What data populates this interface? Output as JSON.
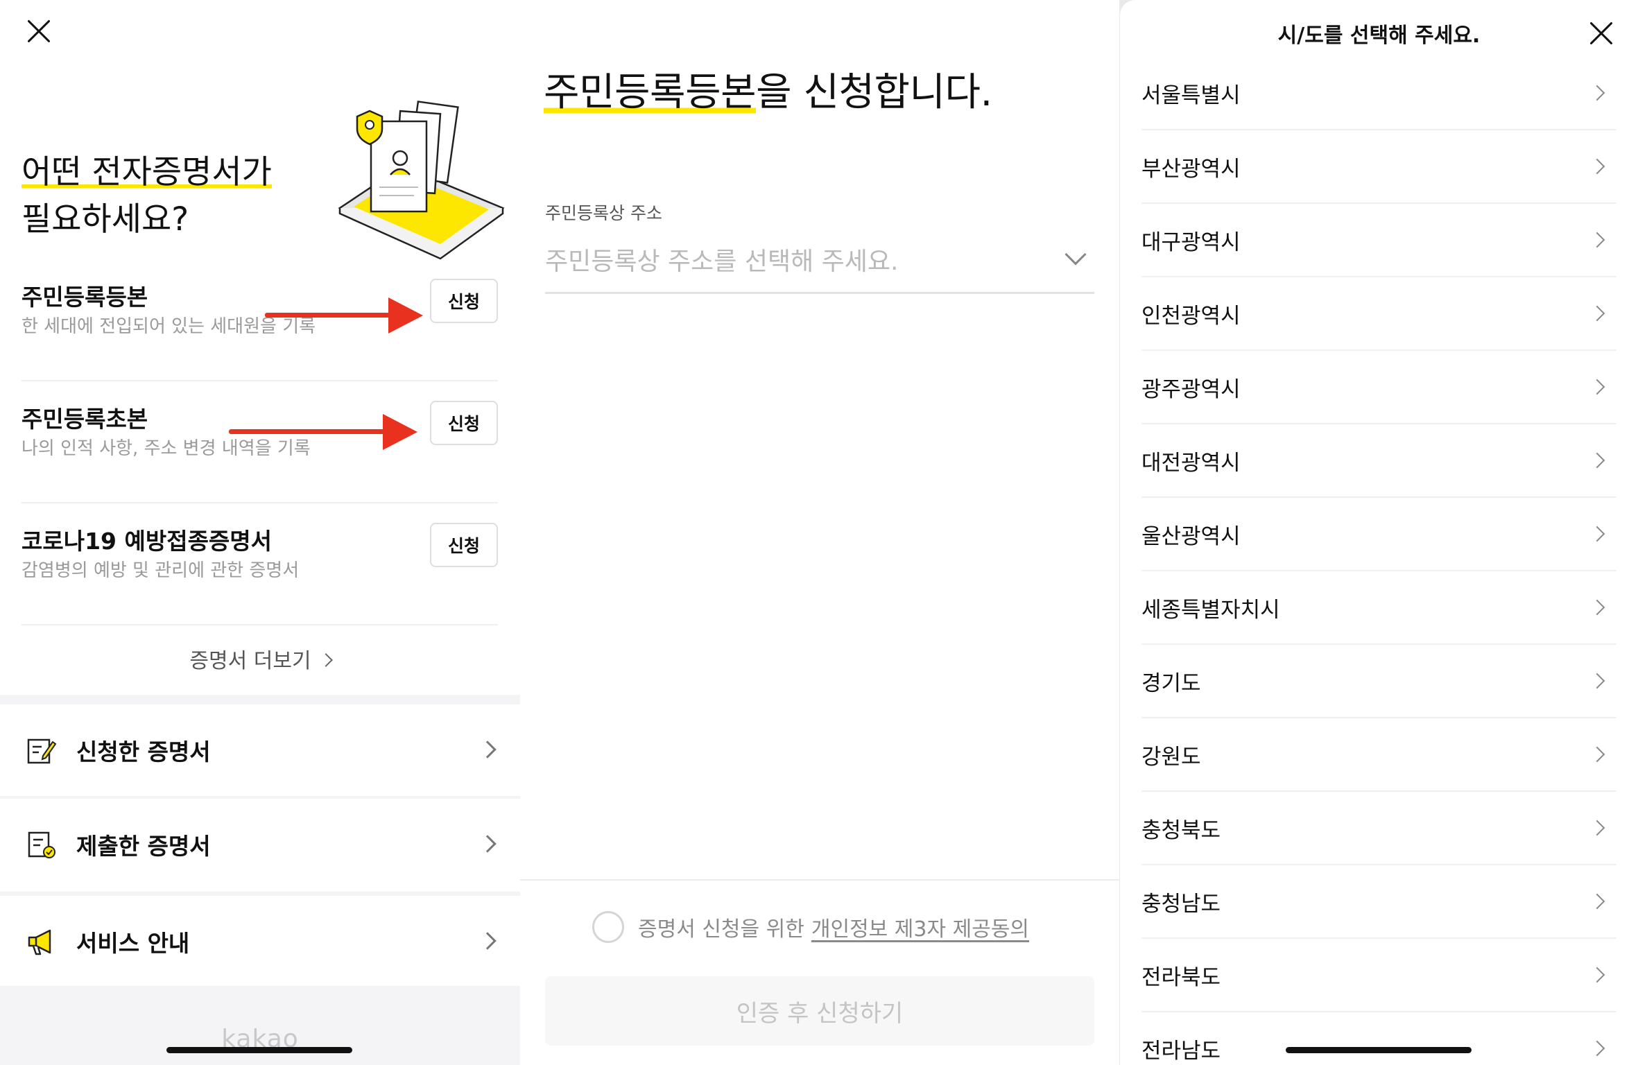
{
  "left": {
    "heading_line1": "어떤 전자증명서가",
    "heading_line2": "필요하세요?",
    "certificates": [
      {
        "title": "주민등록등본",
        "desc": "한 세대에 전입되어 있는 세대원을 기록",
        "button": "신청"
      },
      {
        "title": "주민등록초본",
        "desc": "나의 인적 사항, 주소 변경 내역을 기록",
        "button": "신청"
      },
      {
        "title": "코로나19 예방접종증명서",
        "desc": "감염병의 예방 및 관리에 관한 증명서",
        "button": "신청"
      }
    ],
    "more_link": "증명서 더보기",
    "menu": [
      {
        "label": "신청한 증명서",
        "icon": "edit-document-icon"
      },
      {
        "label": "제출한 증명서",
        "icon": "document-check-icon"
      },
      {
        "label": "서비스 안내",
        "icon": "megaphone-icon"
      }
    ],
    "footer_logo": "kakao",
    "accent_color": "#fde600",
    "arrow_color": "#e8311f"
  },
  "middle": {
    "title_highlight": "주민등록등본",
    "title_rest": "을 신청합니다.",
    "field_label": "주민등록상 주소",
    "field_placeholder": "주민등록상 주소를 선택해 주세요.",
    "consent_text": "증명서 신청을 위한",
    "consent_link": "개인정보 제3자 제공동의",
    "submit_label": "인증 후 신청하기"
  },
  "right": {
    "sheet_title": "시/도를 선택해 주세요.",
    "regions": [
      "서울특별시",
      "부산광역시",
      "대구광역시",
      "인천광역시",
      "광주광역시",
      "대전광역시",
      "울산광역시",
      "세종특별자치시",
      "경기도",
      "강원도",
      "충청북도",
      "충청남도",
      "전라북도",
      "전라남도"
    ]
  }
}
